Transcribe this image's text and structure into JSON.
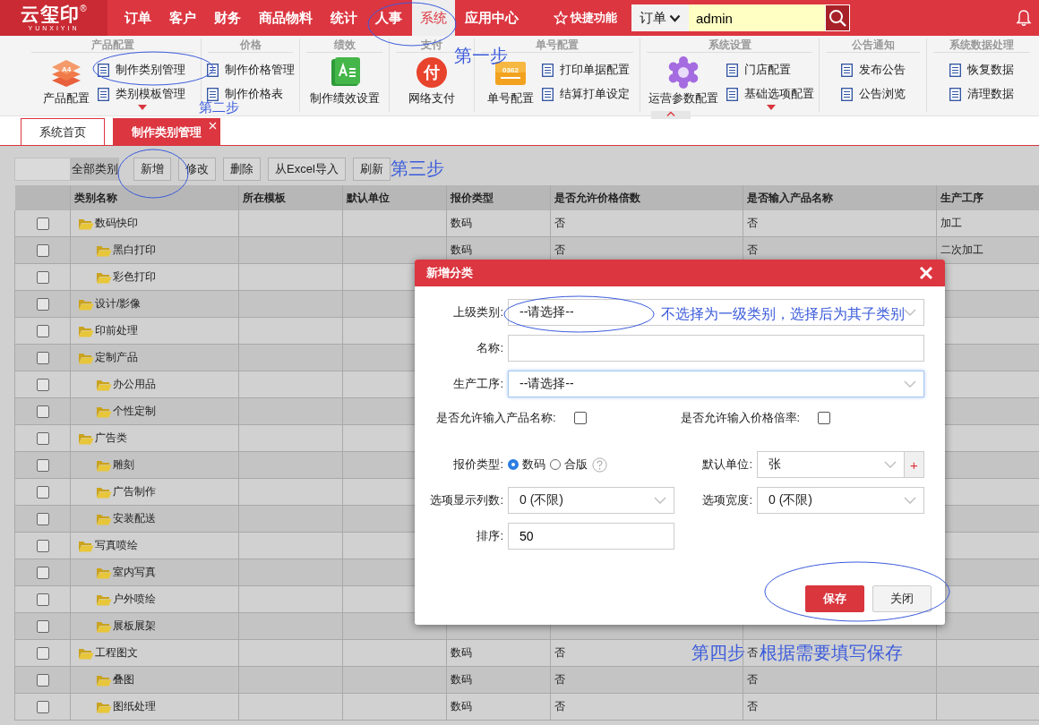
{
  "nav": {
    "logo": "云玺印",
    "logo_mark": "®",
    "logo_sub": "YUNXIYIN",
    "items": [
      {
        "label": "订单",
        "selected": false
      },
      {
        "label": "客户",
        "selected": false
      },
      {
        "label": "财务",
        "selected": false
      },
      {
        "label": "商品物料",
        "selected": false
      },
      {
        "label": "统计",
        "selected": false
      },
      {
        "label": "人事",
        "selected": false
      },
      {
        "label": "系统",
        "selected": true
      },
      {
        "label": "应用中心",
        "selected": false
      }
    ],
    "quick": "快捷功能",
    "search": {
      "scope": "订单",
      "value": "admin"
    }
  },
  "ribbon": {
    "groups": [
      {
        "title": "产品配置",
        "large": [
          {
            "label": "产品配置",
            "kind": "stack",
            "glyph": "A4"
          }
        ],
        "small": [
          {
            "label": "制作类别管理",
            "caret": false
          },
          {
            "label": "类别模板管理",
            "caret": true
          }
        ]
      },
      {
        "title": "价格",
        "small": [
          {
            "label": "制作价格管理",
            "caret": false
          },
          {
            "label": "制作价格表",
            "caret": false
          }
        ]
      },
      {
        "title": "绩效",
        "large": [
          {
            "label": "制作绩效设置",
            "kind": "sheet"
          }
        ]
      },
      {
        "title": "支付",
        "large": [
          {
            "label": "网络支付",
            "kind": "pay",
            "glyph": "付"
          }
        ]
      },
      {
        "title": "单号配置",
        "large": [
          {
            "label": "单号配置",
            "kind": "ticket",
            "glyph": "0362"
          }
        ],
        "small": [
          {
            "label": "打印单据配置",
            "caret": false
          },
          {
            "label": "结算打单设定",
            "caret": false
          }
        ]
      },
      {
        "title": "系统设置",
        "large": [
          {
            "label": "运营参数配置",
            "kind": "gear"
          }
        ],
        "small": [
          {
            "label": "门店配置",
            "caret": false
          },
          {
            "label": "基础选项配置",
            "caret": true
          }
        ]
      },
      {
        "title": "公告通知",
        "small": [
          {
            "label": "发布公告",
            "caret": false
          },
          {
            "label": "公告浏览",
            "caret": false
          }
        ]
      },
      {
        "title": "系统数据处理",
        "small": [
          {
            "label": "恢复数据",
            "caret": false
          },
          {
            "label": "清理数据",
            "caret": false
          }
        ]
      }
    ]
  },
  "tabs": [
    {
      "label": "系统首页",
      "selected": false,
      "closable": false
    },
    {
      "label": "制作类别管理",
      "selected": true,
      "closable": true
    }
  ],
  "toolbar": {
    "filter": "全部类别",
    "buttons": [
      "新增",
      "修改",
      "删除",
      "从Excel导入",
      "刷新"
    ]
  },
  "table": {
    "columns": [
      "类别名称",
      "所在模板",
      "默认单位",
      "报价类型",
      "是否允许价格倍数",
      "是否输入产品名称",
      "生产工序"
    ],
    "rows": [
      {
        "name": "数码快印",
        "checked": false,
        "quote_type": "数码",
        "price_multiple": "否",
        "input_name": "否",
        "process": "加工",
        "children": [
          {
            "name": "黑白打印",
            "checked": false,
            "quote_type": "数码",
            "price_multiple": "否",
            "input_name": "否",
            "process": "二次加工"
          },
          {
            "name": "彩色打印",
            "checked": false
          }
        ]
      },
      {
        "name": "设计/影像",
        "checked": false
      },
      {
        "name": "印前处理",
        "checked": false
      },
      {
        "name": "定制产品",
        "checked": false,
        "children": [
          {
            "name": "办公用品",
            "checked": false
          },
          {
            "name": "个性定制",
            "checked": false
          }
        ]
      },
      {
        "name": "广告类",
        "checked": false,
        "children": [
          {
            "name": "雕刻",
            "checked": false
          },
          {
            "name": "广告制作",
            "checked": false
          },
          {
            "name": "安装配送",
            "checked": false
          }
        ]
      },
      {
        "name": "写真喷绘",
        "checked": false,
        "children": [
          {
            "name": "室内写真",
            "checked": false
          },
          {
            "name": "户外喷绘",
            "checked": false
          },
          {
            "name": "展板展架",
            "checked": false
          }
        ]
      },
      {
        "name": "工程图文",
        "checked": false,
        "quote_type": "数码",
        "price_multiple": "否",
        "input_name": "否",
        "children": [
          {
            "name": "叠图",
            "checked": false,
            "quote_type": "数码",
            "price_multiple": "否",
            "input_name": "否"
          },
          {
            "name": "图纸处理",
            "checked": false,
            "quote_type": "数码",
            "price_multiple": "否",
            "input_name": "否"
          }
        ]
      }
    ]
  },
  "dialog": {
    "title": "新增分类",
    "fields": [
      {
        "kind": "select",
        "label": "上级类别:",
        "value": "--请选择--",
        "focused": false
      },
      {
        "kind": "input",
        "label": "名称:",
        "focused": false
      },
      {
        "kind": "select",
        "label": "生产工序:",
        "value": "--请选择--",
        "focused": true
      }
    ],
    "checks": [
      {
        "label": "是否允许输入产品名称:",
        "checked": false
      },
      {
        "label": "是否允许输入价格倍率:",
        "checked": false
      }
    ],
    "quote": {
      "label": "报价类型:",
      "options": [
        {
          "label": "数码",
          "selected": true
        },
        {
          "label": "合版",
          "selected": false
        }
      ]
    },
    "unit": {
      "label": "默认单位:",
      "value": "张",
      "add": "+"
    },
    "columns_select": {
      "label": "选项显示列数:",
      "value": "0 (不限)"
    },
    "width_select": {
      "label": "选项宽度:",
      "value": "0 (不限)"
    },
    "sort": {
      "label": "排序:",
      "value": "50"
    },
    "buttons": [
      {
        "label": "保存",
        "kind": "primary"
      },
      {
        "label": "关闭",
        "kind": "default"
      }
    ]
  },
  "annotations": [
    "第一步",
    "第二步",
    "第三步",
    "不选择为一级类别，选择后为其子类别",
    "第四步",
    "根据需要填写保存"
  ]
}
